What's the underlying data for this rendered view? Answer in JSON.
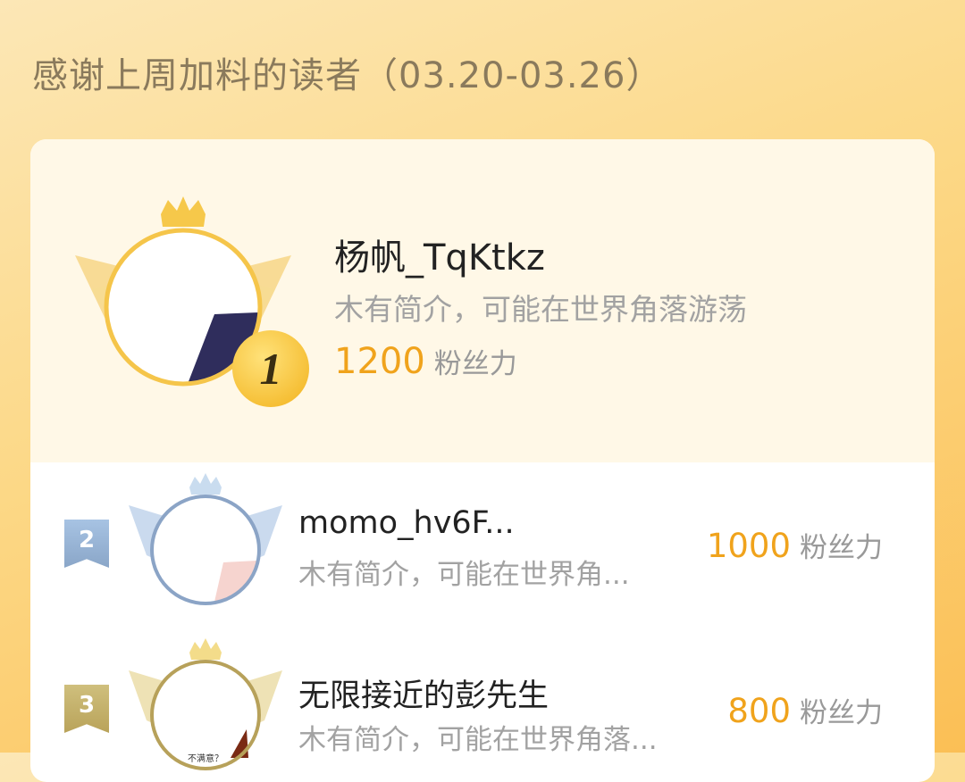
{
  "header": {
    "title": "感谢上周加料的读者（03.20-03.26）"
  },
  "colors": {
    "accent": "#f0a31c",
    "gold": "#f5c54a",
    "silver": "#8aa6c8",
    "bronze": "#b9a35a"
  },
  "top_reader": {
    "rank": "1",
    "name": "杨帆_TqKtkz",
    "bio": "木有简介，可能在世界角落游荡",
    "fans_value": "1200",
    "fans_unit": "粉丝力"
  },
  "readers": [
    {
      "rank": "2",
      "name": "momo_hv6F...",
      "bio": "木有简介，可能在世界角...",
      "fans_value": "1000",
      "fans_unit": "粉丝力"
    },
    {
      "rank": "3",
      "name": "无限接近的彭先生",
      "bio": "木有简介，可能在世界角落...",
      "fans_value": "800",
      "fans_unit": "粉丝力",
      "avatar_caption": "不满意？"
    }
  ]
}
